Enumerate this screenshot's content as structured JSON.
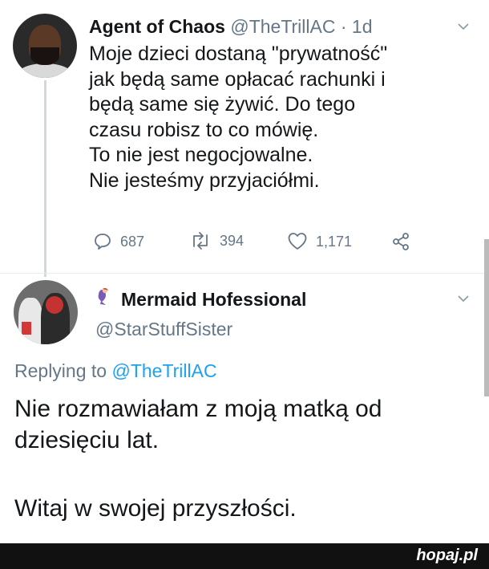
{
  "tweet1": {
    "name": "Agent of Chaos",
    "handle_time": "@TheTrillAC · 1d",
    "lines": [
      "Moje dzieci dostaną \"prywatność\"",
      "jak będą same opłacać rachunki i",
      "będą same się żywić. Do tego",
      "czasu robisz to co mówię.",
      "To nie jest negocjowalne.",
      "Nie jesteśmy przyjaciółmi."
    ],
    "replies": "687",
    "retweets": "394",
    "likes": "1,171"
  },
  "tweet2": {
    "name": "Mermaid Hofessional",
    "handle": "@StarStuffSister",
    "replying_prefix": "Replying to",
    "replying_to": "@TheTrillAC",
    "line1": "Nie rozmawiałam z moją matką od",
    "line2": "dziesięciu lat.",
    "line3": "Witaj w swojej przyszłości."
  },
  "footer": {
    "brand": "hopaj.pl"
  },
  "colors": {
    "link": "#1da1f2",
    "secondary": "#657786",
    "text": "#14171a"
  }
}
